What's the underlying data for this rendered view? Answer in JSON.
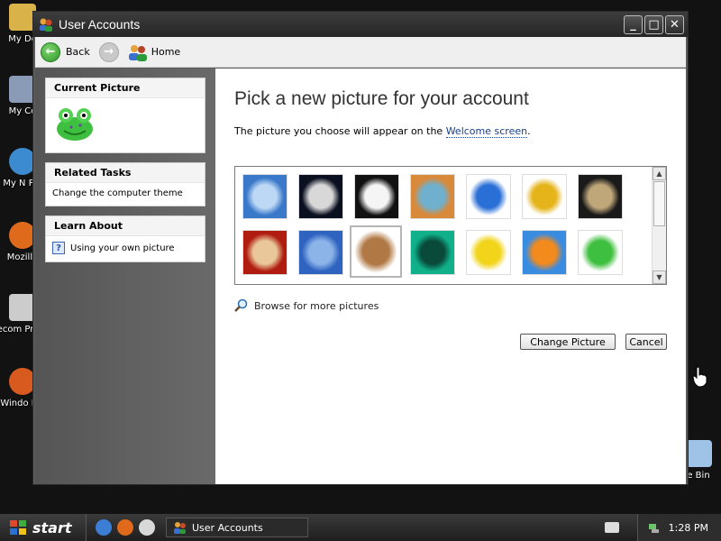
{
  "desktop": {
    "icons": [
      {
        "label": "My Do",
        "icon": "folder-icon",
        "color": "#d9b34a"
      },
      {
        "label": "My Co",
        "icon": "computer-icon",
        "color": "#8a9bb8"
      },
      {
        "label": "My N Pla",
        "icon": "network-icon",
        "color": "#3c8ad0"
      },
      {
        "label": "Mozilla",
        "icon": "firefox-icon",
        "color": "#e06a1c"
      },
      {
        "label": "Recom Progra",
        "icon": "program-icon",
        "color": "#cccccc"
      },
      {
        "label": "Windo Pla",
        "icon": "media-player-icon",
        "color": "#d85a1f"
      },
      {
        "label": "e Bin",
        "icon": "recycle-bin-icon",
        "color": "#9fc3e6"
      }
    ]
  },
  "window": {
    "title": "User Accounts",
    "toolbar": {
      "back_label": "Back",
      "home_label": "Home"
    },
    "sidebar": {
      "current_picture": {
        "heading": "Current Picture",
        "picture": "frog"
      },
      "related_tasks": {
        "heading": "Related Tasks",
        "items": [
          "Change the computer theme"
        ]
      },
      "learn_about": {
        "heading": "Learn About",
        "items": [
          "Using your own picture"
        ]
      }
    },
    "main": {
      "heading": "Pick a new picture for your account",
      "subtext_prefix": "The picture you choose will appear on the ",
      "subtext_link": "Welcome screen",
      "subtext_suffix": ".",
      "pictures": [
        {
          "name": "airplane",
          "colors": [
            "#3a78c9",
            "#bcd8f5"
          ]
        },
        {
          "name": "astronaut",
          "colors": [
            "#0b1020",
            "#d8d8d8"
          ]
        },
        {
          "name": "soccer ball",
          "colors": [
            "#111111",
            "#f5f5f5"
          ]
        },
        {
          "name": "beach chairs",
          "colors": [
            "#d9893a",
            "#6fb0cf"
          ]
        },
        {
          "name": "butterfly",
          "colors": [
            "#ffffff",
            "#2a6fd6"
          ]
        },
        {
          "name": "race car",
          "colors": [
            "#ffffff",
            "#e5b31a"
          ]
        },
        {
          "name": "owl",
          "colors": [
            "#1a1a1a",
            "#bfa77a"
          ]
        },
        {
          "name": "chess",
          "colors": [
            "#b01d10",
            "#e9c79a"
          ]
        },
        {
          "name": "dirt bike",
          "colors": [
            "#2f63c0",
            "#8cb4e8"
          ]
        },
        {
          "name": "dog",
          "colors": [
            "#ffffff",
            "#b07844"
          ]
        },
        {
          "name": "drip",
          "colors": [
            "#0fb08a",
            "#0a4a3a"
          ]
        },
        {
          "name": "duck",
          "colors": [
            "#ffffff",
            "#f2d41a"
          ]
        },
        {
          "name": "fish",
          "colors": [
            "#3a8ce0",
            "#f28a1e"
          ]
        },
        {
          "name": "frog",
          "colors": [
            "#ffffff",
            "#3fbf3f"
          ]
        }
      ],
      "selected_picture": "dog",
      "browse_label": "Browse for more pictures",
      "change_button": "Change Picture",
      "cancel_button": "Cancel"
    }
  },
  "taskbar": {
    "start_label": "start",
    "task_label": "User Accounts",
    "clock": "1:28 PM"
  }
}
